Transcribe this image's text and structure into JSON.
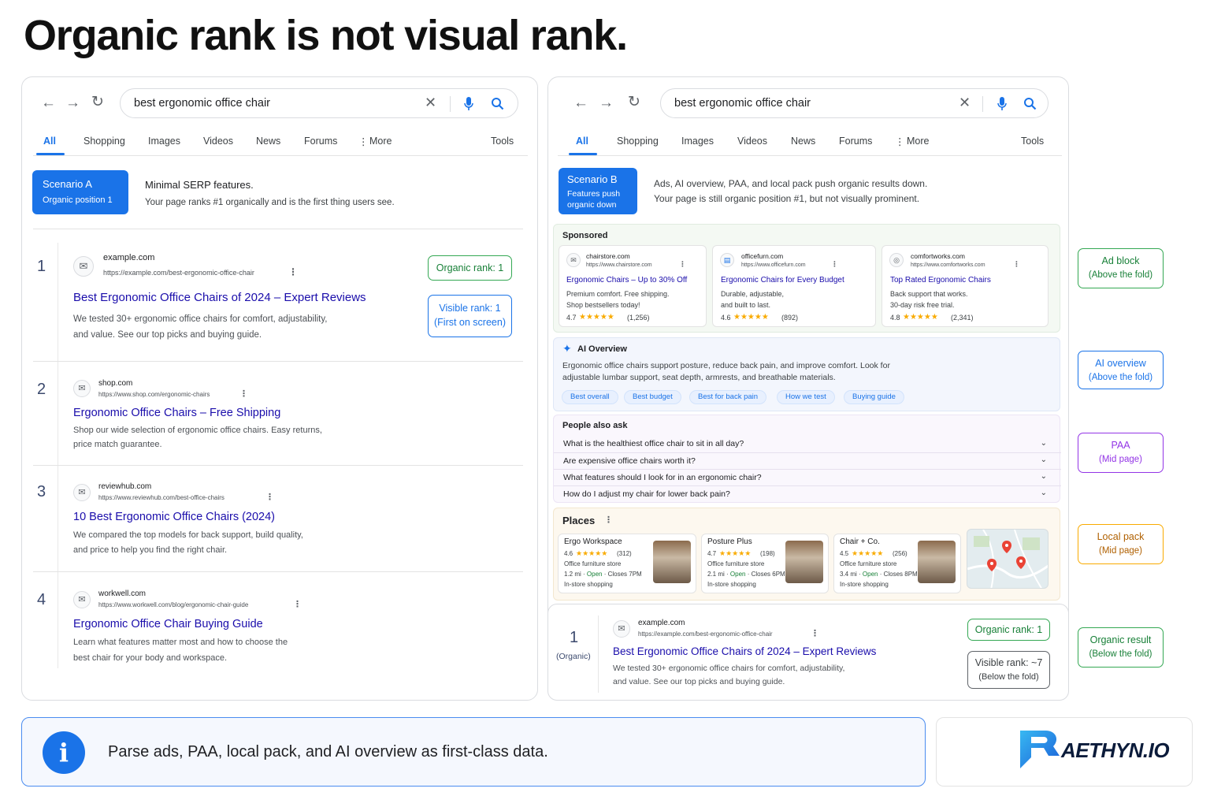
{
  "headline": "Organic rank is not visual rank.",
  "query": "best ergonomic office chair",
  "tabs": [
    "All",
    "Shopping",
    "Images",
    "Videos",
    "News",
    "Forums",
    "More",
    "Tools"
  ],
  "scenario_a": {
    "badge_title": "Scenario A",
    "badge_sub": "Organic position 1",
    "desc_title": "Minimal SERP features.",
    "desc_body": "Your page ranks #1 organically and is the first thing users see.",
    "results": [
      {
        "rank": "1",
        "site": "example.com",
        "url": "https://example.com/best-ergonomic-office-chair",
        "title": "Best Ergonomic Office Chairs of 2024 – Expert Reviews",
        "line1": "We tested 30+ ergonomic office chairs for comfort, adjustability,",
        "line2": "and value. See our top picks and buying guide."
      },
      {
        "rank": "2",
        "site": "shop.com",
        "url": "https://www.shop.com/ergonomic-chairs",
        "title": "Ergonomic Office Chairs – Free Shipping",
        "line1": "Shop our wide selection of ergonomic office chairs. Easy returns,",
        "line2": "price match guarantee."
      },
      {
        "rank": "3",
        "site": "reviewhub.com",
        "url": "https://www.reviewhub.com/best-office-chairs",
        "title": "10 Best Ergonomic Office Chairs (2024)",
        "line1": "We compared the top models for back support, build quality,",
        "line2": "and price to help you find the right chair."
      },
      {
        "rank": "4",
        "site": "workwell.com",
        "url": "https://www.workwell.com/blog/ergonomic-chair-guide",
        "title": "Ergonomic Office Chair Buying Guide",
        "line1": "Learn what features matter most and how to choose the",
        "line2": "best chair for your body and workspace."
      }
    ],
    "organic_badge": "Organic rank: 1",
    "visible_badge_l1": "Visible rank: 1",
    "visible_badge_l2": "(First on screen)"
  },
  "scenario_b": {
    "badge_title": "Scenario B",
    "badge_sub1": "Features push",
    "badge_sub2": "organic down",
    "desc_line1": "Ads, AI overview, PAA, and local pack push organic results down.",
    "desc_line2": "Your page is still organic position #1, but not visually prominent.",
    "sponsored_label": "Sponsored",
    "ads": [
      {
        "site": "chairstore.com",
        "url": "https://www.chairstore.com",
        "title": "Ergonomic Chairs – Up to 30% Off",
        "l1": "Premium comfort. Free shipping.",
        "l2": "Shop bestsellers today!",
        "rating": "4.7",
        "stars": "★★★★★",
        "count": "(1,256)"
      },
      {
        "site": "officefurn.com",
        "url": "https://www.officefurn.com",
        "title": "Ergonomic Chairs for Every Budget",
        "l1": "Durable, adjustable,",
        "l2": "and built to last.",
        "rating": "4.6",
        "stars": "★★★★★",
        "count": "(892)"
      },
      {
        "site": "comfortworks.com",
        "url": "https://www.comfortworks.com",
        "title": "Top Rated Ergonomic Chairs",
        "l1": "Back support that works.",
        "l2": "30-day risk free trial.",
        "rating": "4.8",
        "stars": "★★★★★",
        "count": "(2,341)"
      }
    ],
    "ai_label": "AI Overview",
    "ai_l1": "Ergonomic office chairs support posture, reduce back pain, and improve comfort. Look for",
    "ai_l2": "adjustable lumbar support, seat depth, armrests, and breathable materials.",
    "ai_chips": [
      "Best overall",
      "Best budget",
      "Best for back pain",
      "How we test",
      "Buying guide"
    ],
    "paa_label": "People also ask",
    "paa": [
      "What is the healthiest office chair to sit in all day?",
      "Are expensive office chairs worth it?",
      "What features should I look for in an ergonomic chair?",
      "How do I adjust my chair for lower back pain?"
    ],
    "places_label": "Places",
    "places": [
      {
        "name": "Ergo Workspace",
        "rating": "4.6",
        "stars": "★★★★★",
        "count": "(312)",
        "type": "Office furniture store",
        "dist": "1.2 mi · ",
        "open": "Open",
        "close": " · Closes 7PM",
        "extra": "In-store shopping"
      },
      {
        "name": "Posture Plus",
        "rating": "4.7",
        "stars": "★★★★★",
        "count": "(198)",
        "type": "Office furniture store",
        "dist": "2.1 mi · ",
        "open": "Open",
        "close": " · Closes 6PM",
        "extra": "In-store shopping"
      },
      {
        "name": "Chair + Co.",
        "rating": "4.5",
        "stars": "★★★★★",
        "count": "(256)",
        "type": "Office furniture store",
        "dist": "3.4 mi · ",
        "open": "Open",
        "close": " · Closes 8PM",
        "extra": "In-store shopping"
      }
    ],
    "organic": {
      "rank": "1",
      "rank_label": "(Organic)",
      "site": "example.com",
      "url": "https://example.com/best-ergonomic-office-chair",
      "title": "Best Ergonomic Office Chairs of 2024 – Expert Reviews",
      "line1": "We tested 30+ ergonomic office chairs for comfort, adjustability,",
      "line2": "and value. See our top picks and buying guide."
    },
    "organic_badge": "Organic rank: 1",
    "visible_badge_l1": "Visible rank: ~7",
    "visible_badge_l2": "(Below the fold)"
  },
  "side_labels": [
    {
      "l1": "Ad block",
      "l2": "(Above the fold)"
    },
    {
      "l1": "AI overview",
      "l2": "(Above the fold)"
    },
    {
      "l1": "PAA",
      "l2": "(Mid page)"
    },
    {
      "l1": "Local pack",
      "l2": "(Mid page)"
    },
    {
      "l1": "Organic result",
      "l2": "(Below the fold)"
    }
  ],
  "footer_text": "Parse ads, PAA, local pack, and AI overview as first-class data.",
  "logo_text": "AETHYN.IO",
  "colors": {
    "accent": "#1a73e8",
    "link": "#1a0dab",
    "green": "#34a853",
    "purple": "#9334e6",
    "orange": "#f9ab00"
  }
}
